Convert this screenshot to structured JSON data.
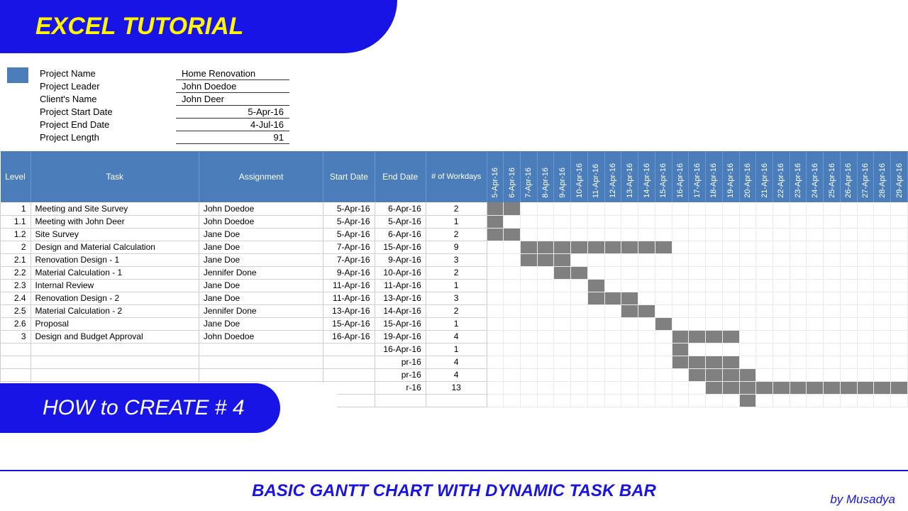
{
  "header": {
    "title": "EXCEL TUTORIAL"
  },
  "project": {
    "rows": [
      {
        "label": "Project Name",
        "value": "Home Renovation",
        "align": "left"
      },
      {
        "label": "Project Leader",
        "value": "John Doedoe",
        "align": "left"
      },
      {
        "label": "Client's Name",
        "value": "John Deer",
        "align": "left"
      },
      {
        "label": "Project Start Date",
        "value": "5-Apr-16",
        "align": "right"
      },
      {
        "label": "Project End Date",
        "value": "4-Jul-16",
        "align": "right"
      },
      {
        "label": "Project Length",
        "value": "91",
        "align": "right"
      }
    ]
  },
  "columns": {
    "level": "Level",
    "task": "Task",
    "assignment": "Assignment",
    "start": "Start Date",
    "end": "End Date",
    "workdays": "# of Workdays"
  },
  "footer": {
    "howto": "HOW to CREATE # 4",
    "title": "BASIC GANTT CHART WITH DYNAMIC TASK BAR",
    "author": "by Musadya"
  },
  "chart_data": {
    "type": "bar",
    "title": "Basic Gantt Chart with Dynamic Task Bar",
    "xlabel": "Date",
    "ylabel": "Task",
    "date_columns": [
      "5-Apr-16",
      "6-Apr-16",
      "7-Apr-16",
      "8-Apr-16",
      "9-Apr-16",
      "10-Apr-16",
      "11-Apr-16",
      "12-Apr-16",
      "13-Apr-16",
      "14-Apr-16",
      "15-Apr-16",
      "16-Apr-16",
      "17-Apr-16",
      "18-Apr-16",
      "19-Apr-16",
      "20-Apr-16",
      "21-Apr-16",
      "22-Apr-16",
      "23-Apr-16",
      "24-Apr-16",
      "25-Apr-16",
      "26-Apr-16",
      "27-Apr-16",
      "28-Apr-16",
      "29-Apr-16"
    ],
    "rows": [
      {
        "level": "1",
        "task": "Meeting and Site Survey",
        "assignment": "John Doedoe",
        "start": "5-Apr-16",
        "end": "6-Apr-16",
        "workdays": "2",
        "bar_start": 0,
        "bar_end": 1
      },
      {
        "level": "1.1",
        "task": "Meeting with John Deer",
        "assignment": "John Doedoe",
        "start": "5-Apr-16",
        "end": "5-Apr-16",
        "workdays": "1",
        "bar_start": 0,
        "bar_end": 0
      },
      {
        "level": "1.2",
        "task": "Site Survey",
        "assignment": "Jane Doe",
        "start": "5-Apr-16",
        "end": "6-Apr-16",
        "workdays": "2",
        "bar_start": 0,
        "bar_end": 1
      },
      {
        "level": "2",
        "task": "Design and Material Calculation",
        "assignment": "Jane Doe",
        "start": "7-Apr-16",
        "end": "15-Apr-16",
        "workdays": "9",
        "bar_start": 2,
        "bar_end": 10
      },
      {
        "level": "2.1",
        "task": "Renovation Design - 1",
        "assignment": "Jane Doe",
        "start": "7-Apr-16",
        "end": "9-Apr-16",
        "workdays": "3",
        "bar_start": 2,
        "bar_end": 4
      },
      {
        "level": "2.2",
        "task": "Material Calculation - 1",
        "assignment": "Jennifer Done",
        "start": "9-Apr-16",
        "end": "10-Apr-16",
        "workdays": "2",
        "bar_start": 4,
        "bar_end": 5
      },
      {
        "level": "2.3",
        "task": "Internal Review",
        "assignment": "Jane Doe",
        "start": "11-Apr-16",
        "end": "11-Apr-16",
        "workdays": "1",
        "bar_start": 6,
        "bar_end": 6
      },
      {
        "level": "2.4",
        "task": "Renovation Design - 2",
        "assignment": "Jane Doe",
        "start": "11-Apr-16",
        "end": "13-Apr-16",
        "workdays": "3",
        "bar_start": 6,
        "bar_end": 8
      },
      {
        "level": "2.5",
        "task": "Material Calculation - 2",
        "assignment": "Jennifer Done",
        "start": "13-Apr-16",
        "end": "14-Apr-16",
        "workdays": "2",
        "bar_start": 8,
        "bar_end": 9
      },
      {
        "level": "2.6",
        "task": "Proposal",
        "assignment": "Jane Doe",
        "start": "15-Apr-16",
        "end": "15-Apr-16",
        "workdays": "1",
        "bar_start": 10,
        "bar_end": 10
      },
      {
        "level": "3",
        "task": "Design and Budget Approval",
        "assignment": "John Doedoe",
        "start": "16-Apr-16",
        "end": "19-Apr-16",
        "workdays": "4",
        "bar_start": 11,
        "bar_end": 14
      },
      {
        "level": "",
        "task": "",
        "assignment": "",
        "start": "",
        "end": "16-Apr-16",
        "workdays": "1",
        "bar_start": 11,
        "bar_end": 11
      },
      {
        "level": "",
        "task": "",
        "assignment": "",
        "start": "",
        "end": "pr-16",
        "workdays": "4",
        "bar_start": 11,
        "bar_end": 14
      },
      {
        "level": "",
        "task": "",
        "assignment": "",
        "start": "",
        "end": "pr-16",
        "workdays": "4",
        "bar_start": 12,
        "bar_end": 15
      },
      {
        "level": "",
        "task": "",
        "assignment": "",
        "start": "",
        "end": "r-16",
        "workdays": "13",
        "bar_start": 13,
        "bar_end": 24
      },
      {
        "level": "",
        "task": "",
        "assignment": "",
        "start": "",
        "end": "",
        "workdays": "",
        "bar_start": 15,
        "bar_end": 15
      }
    ]
  }
}
